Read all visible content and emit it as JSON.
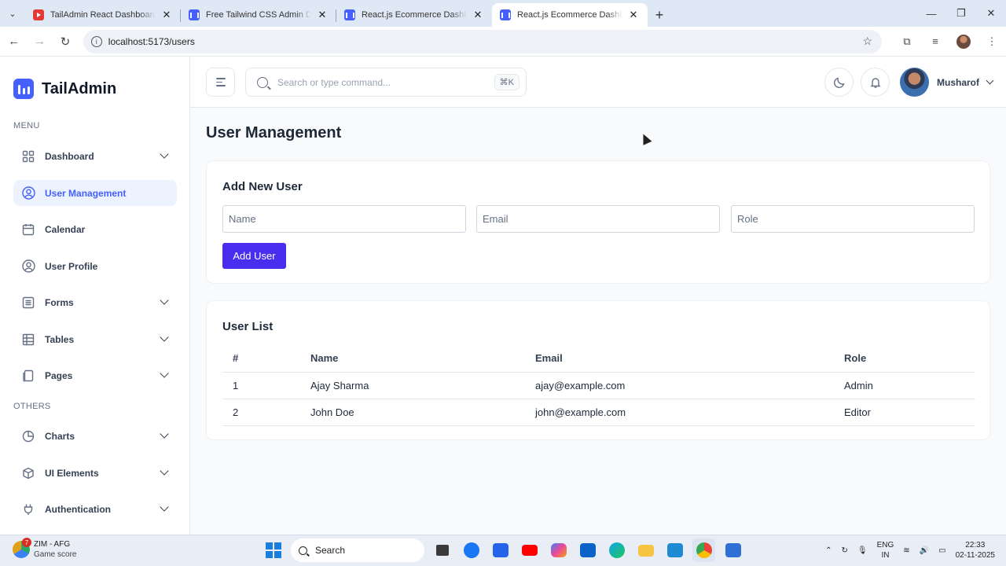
{
  "browser": {
    "tabs": [
      {
        "title": "TailAdmin React Dashboard — T",
        "favicon": "youtube-icon"
      },
      {
        "title": "Free Tailwind CSS Admin Dashb",
        "favicon": "tailadmin-icon"
      },
      {
        "title": "React.js Ecommerce Dashboard",
        "favicon": "tailadmin-icon"
      },
      {
        "title": "React.js Ecommerce Dashboard",
        "favicon": "tailadmin-icon",
        "active": true
      }
    ],
    "url": "localhost:5173/users"
  },
  "app": {
    "logo_text": "TailAdmin",
    "brand_color": "#465fff",
    "sidebar": {
      "menu_heading": "MENU",
      "others_heading": "OTHERS",
      "items": [
        {
          "label": "Dashboard",
          "icon": "grid-icon",
          "has_chevron": true
        },
        {
          "label": "User Management",
          "icon": "user-circle-icon",
          "active": true
        },
        {
          "label": "Calendar",
          "icon": "calendar-icon"
        },
        {
          "label": "User Profile",
          "icon": "user-circle-icon"
        },
        {
          "label": "Forms",
          "icon": "list-icon",
          "has_chevron": true
        },
        {
          "label": "Tables",
          "icon": "table-icon",
          "has_chevron": true
        },
        {
          "label": "Pages",
          "icon": "page-icon",
          "has_chevron": true
        }
      ],
      "other_items": [
        {
          "label": "Charts",
          "icon": "pie-chart-icon",
          "has_chevron": true
        },
        {
          "label": "UI Elements",
          "icon": "box-icon",
          "has_chevron": true
        },
        {
          "label": "Authentication",
          "icon": "plug-icon",
          "has_chevron": true
        }
      ]
    },
    "header": {
      "search_placeholder": "Search or type command...",
      "search_shortcut": "⌘K",
      "user_name": "Musharof"
    },
    "page_title": "User Management",
    "add_user": {
      "title": "Add New User",
      "name_placeholder": "Name",
      "email_placeholder": "Email",
      "role_placeholder": "Role",
      "button_label": "Add User",
      "button_color": "#4a2ef0"
    },
    "user_list": {
      "title": "User List",
      "columns": [
        "#",
        "Name",
        "Email",
        "Role"
      ],
      "rows": [
        [
          "1",
          "Ajay Sharma",
          "ajay@example.com",
          "Admin"
        ],
        [
          "2",
          "John Doe",
          "john@example.com",
          "Editor"
        ]
      ]
    }
  },
  "taskbar": {
    "weather_title": "ZIM - AFG",
    "weather_sub": "Game score",
    "weather_badge": "7",
    "search_label": "Search",
    "lang_top": "ENG",
    "lang_bottom": "IN",
    "time": "22:33",
    "date": "02-11-2025"
  }
}
